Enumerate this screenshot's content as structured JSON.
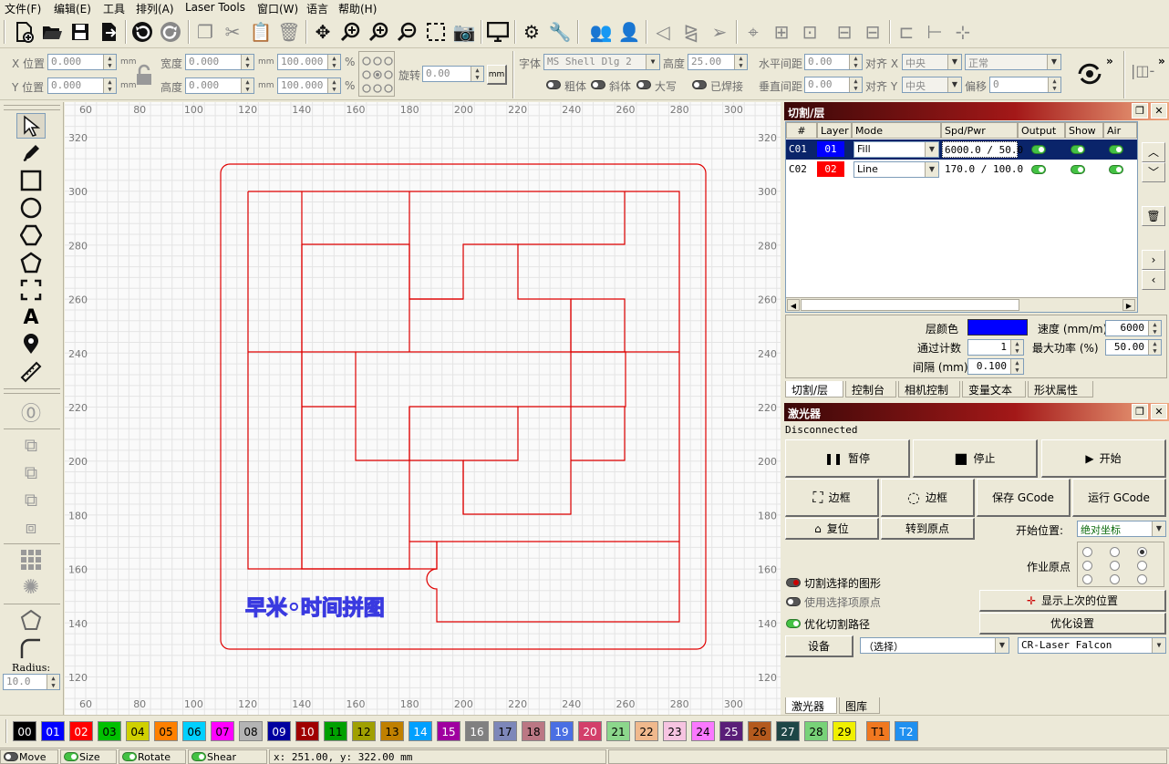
{
  "menu": [
    "文件(F)",
    "编辑(E)",
    "工具",
    "排列(A)",
    "Laser Tools",
    "窗口(W)",
    "语言",
    "帮助(H)"
  ],
  "props": {
    "x_pos_label": "X 位置",
    "x_pos_value": "0.000",
    "y_pos_label": "Y 位置",
    "y_pos_value": "0.000",
    "unit_mm": "mm",
    "width_label": "宽度",
    "width_value": "0.000",
    "height_label": "高度",
    "height_value": "0.000",
    "scale_w": "100.000",
    "scale_h": "100.000",
    "percent": "%",
    "rotate_label": "旋转",
    "rotate_value": "0.00",
    "mm_button": "mm",
    "font_label": "字体",
    "font_value": "MS Shell Dlg 2",
    "font_height_label": "高度",
    "font_height_value": "25.00",
    "hspace_label": "水平间距",
    "hspace_value": "0.00",
    "vspace_label": "垂直间距",
    "vspace_value": "0.00",
    "alignx_label": "对齐 X",
    "alignx_value": "中央",
    "aligny_label": "对齐 Y",
    "aligny_value": "中央",
    "style_value": "正常",
    "offset_label": "偏移",
    "offset_value": "0",
    "bold": "粗体",
    "italic": "斜体",
    "upper": "大写",
    "welded": "已焊接"
  },
  "left_tools": {
    "radius_label": "Radius:",
    "radius_value": "10.0"
  },
  "canvas": {
    "x_ticks": [
      "60",
      "80",
      "100",
      "120",
      "140",
      "160",
      "180",
      "200",
      "220",
      "240",
      "260",
      "280",
      "300"
    ],
    "y_ticks": [
      "320",
      "300",
      "280",
      "260",
      "240",
      "220",
      "200",
      "180",
      "160",
      "140",
      "120"
    ],
    "caption": "早米◦时间拼图",
    "line_color": "#e00000",
    "caption_color": "#3a3ae0"
  },
  "cuts_panel": {
    "title": "切割/层",
    "headers": [
      "#",
      "Layer",
      "Mode",
      "Spd/Pwr",
      "Output",
      "Show",
      "Air"
    ],
    "rows": [
      {
        "id": "C01",
        "layer": "01",
        "layer_color": "#0000ff",
        "mode": "Fill",
        "spdpwr": "6000.0 / 50.0",
        "selected": true
      },
      {
        "id": "C02",
        "layer": "02",
        "layer_color": "#ff0000",
        "mode": "Line",
        "spdpwr": "170.0 / 100.0",
        "selected": false
      }
    ],
    "layer_color_label": "层颜色",
    "speed_label": "速度 (mm/m)",
    "speed_value": "6000",
    "passes_label": "通过计数",
    "passes_value": "1",
    "maxpower_label": "最大功率 (%)",
    "maxpower_value": "50.00",
    "interval_label": "间隔 (mm)",
    "interval_value": "0.100",
    "tabs": [
      "切割/层",
      "控制台",
      "相机控制",
      "变量文本",
      "形状属性"
    ]
  },
  "laser_panel": {
    "title": "激光器",
    "status": "Disconnected",
    "pause": "暂停",
    "stop": "停止",
    "start": "开始",
    "frame1": "边框",
    "frame2": "边框",
    "save_gcode": "保存 GCode",
    "run_gcode": "运行 GCode",
    "home": "复位",
    "goto_origin": "转到原点",
    "start_pos_label": "开始位置:",
    "start_pos_value": "绝对坐标",
    "job_origin_label": "作业原点",
    "cut_selected": "切割选择的图形",
    "use_selection_origin": "使用选择项原点",
    "optimize_path": "优化切割路径",
    "show_last_pos": "显示上次的位置",
    "optimize_settings": "优化设置",
    "device_button": "设备",
    "select_value": "（选择）",
    "device_value": "CR-Laser Falcon",
    "tabs": [
      "激光器",
      "图库"
    ]
  },
  "palette": [
    {
      "label": "00",
      "color": "#000000",
      "text": "#ffffff"
    },
    {
      "label": "01",
      "color": "#0000ff",
      "text": "#ffffff"
    },
    {
      "label": "02",
      "color": "#ff0000",
      "text": "#ffffff"
    },
    {
      "label": "03",
      "color": "#00c000",
      "text": "#000000"
    },
    {
      "label": "04",
      "color": "#d0d000",
      "text": "#000000"
    },
    {
      "label": "05",
      "color": "#ff8000",
      "text": "#000000"
    },
    {
      "label": "06",
      "color": "#00d0ff",
      "text": "#000000"
    },
    {
      "label": "07",
      "color": "#ff00ff",
      "text": "#000000"
    },
    {
      "label": "08",
      "color": "#b4b4b4",
      "text": "#000000"
    },
    {
      "label": "09",
      "color": "#0000a0",
      "text": "#ffffff"
    },
    {
      "label": "10",
      "color": "#a00000",
      "text": "#ffffff"
    },
    {
      "label": "11",
      "color": "#00a000",
      "text": "#000000"
    },
    {
      "label": "12",
      "color": "#a0a000",
      "text": "#000000"
    },
    {
      "label": "13",
      "color": "#c08000",
      "text": "#000000"
    },
    {
      "label": "14",
      "color": "#00a0ff",
      "text": "#ffffff"
    },
    {
      "label": "15",
      "color": "#a000a0",
      "text": "#ffffff"
    },
    {
      "label": "16",
      "color": "#808080",
      "text": "#ffffff"
    },
    {
      "label": "17",
      "color": "#7d87b9",
      "text": "#000000"
    },
    {
      "label": "18",
      "color": "#bb7784",
      "text": "#000000"
    },
    {
      "label": "19",
      "color": "#4a6fe3",
      "text": "#ffffff"
    },
    {
      "label": "20",
      "color": "#d33f6a",
      "text": "#ffffff"
    },
    {
      "label": "21",
      "color": "#8cd78c",
      "text": "#000000"
    },
    {
      "label": "22",
      "color": "#f0b98d",
      "text": "#000000"
    },
    {
      "label": "23",
      "color": "#f6c4e1",
      "text": "#000000"
    },
    {
      "label": "24",
      "color": "#fa78ff",
      "text": "#000000"
    },
    {
      "label": "25",
      "color": "#5a1e78",
      "text": "#ffffff"
    },
    {
      "label": "26",
      "color": "#b45a1e",
      "text": "#000000"
    },
    {
      "label": "27",
      "color": "#1e4646",
      "text": "#ffffff"
    },
    {
      "label": "28",
      "color": "#78d278",
      "text": "#000000"
    },
    {
      "label": "29",
      "color": "#f0f000",
      "text": "#000000"
    },
    {
      "label": "T1",
      "color": "#f07820",
      "text": "#000000"
    },
    {
      "label": "T2",
      "color": "#2090f0",
      "text": "#ffffff"
    }
  ],
  "status": {
    "move": "Move",
    "size": "Size",
    "rotate": "Rotate",
    "shear": "Shear",
    "coords": "x: 251.00, y: 322.00 mm"
  }
}
